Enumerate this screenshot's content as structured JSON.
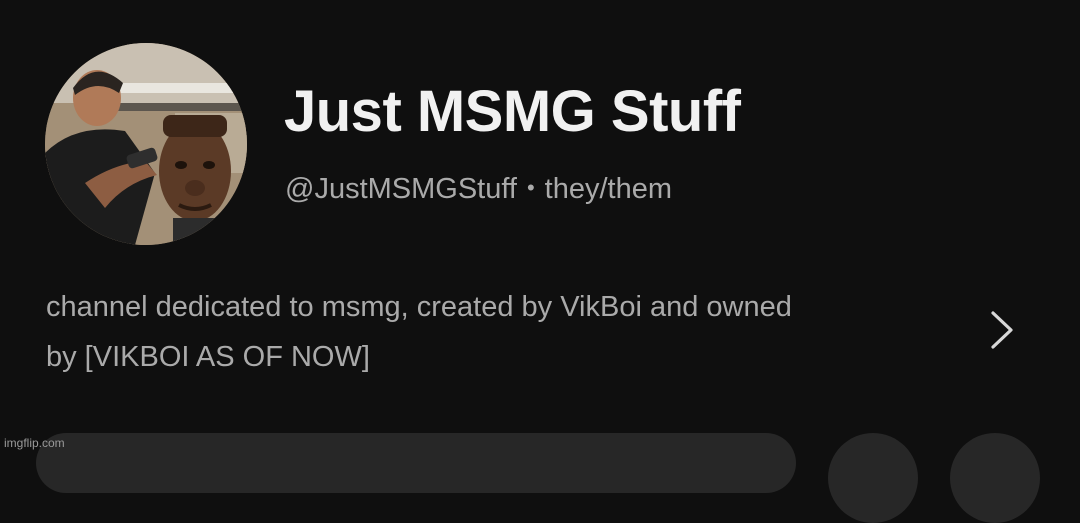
{
  "channel": {
    "name": "Just MSMG Stuff",
    "handle": "@JustMSMGStuff",
    "separator": "•",
    "pronouns": "they/them"
  },
  "description": {
    "line1": "channel dedicated to msmg, created by VikBoi and owned",
    "line2": "by [VIKBOI AS OF NOW]"
  },
  "icons": {
    "avatar": "channel-avatar",
    "more": "chevron-right-icon"
  },
  "watermark": "imgflip.com",
  "colors": {
    "background": "#0f0f0f",
    "title": "#f1f1f1",
    "secondary_text": "#aaaaaa",
    "button_surface": "#272727"
  }
}
